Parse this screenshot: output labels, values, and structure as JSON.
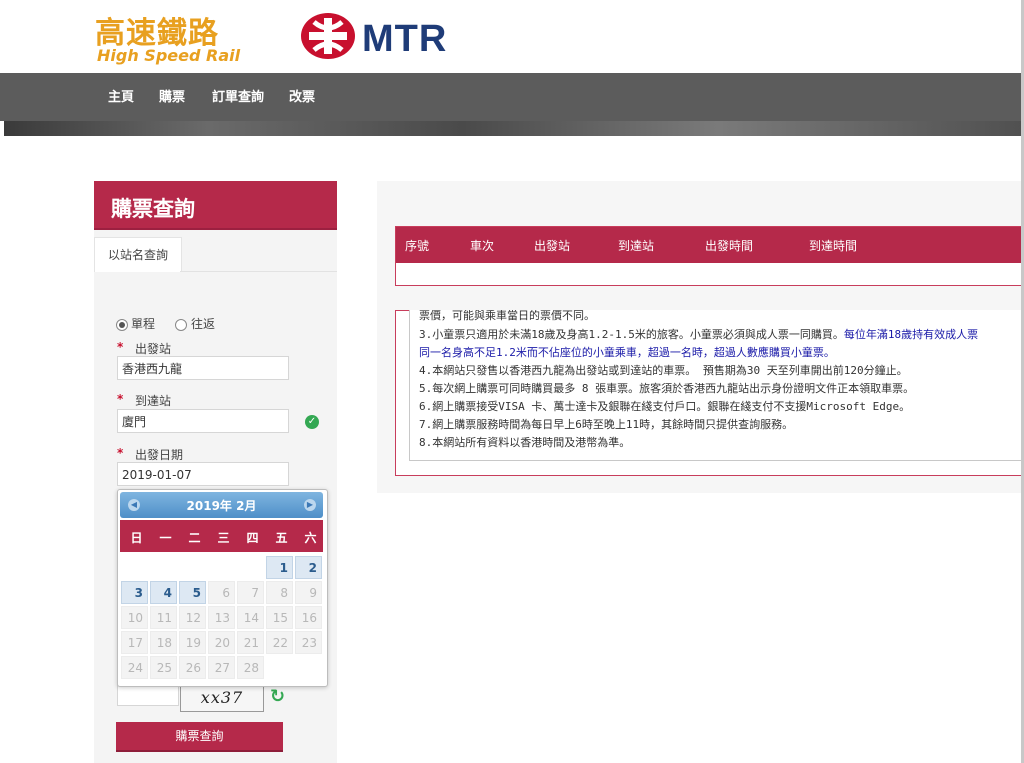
{
  "header": {
    "logo_cn": "高速鐵路",
    "logo_en": "High Speed Rail",
    "mtr_text": "MTR",
    "brand_orange": "#e8a020",
    "brand_red": "#c8102e",
    "mtr_blue": "#1f3c78"
  },
  "nav": {
    "items": [
      "主頁",
      "購票",
      "訂單查詢",
      "改票"
    ]
  },
  "panel": {
    "title": "購票查詢",
    "tab": "以站名查詢",
    "trip_one_way": "單程",
    "trip_return": "往返",
    "selected_trip": "單程",
    "departure_label": "出發站",
    "departure_value": "香港西九龍",
    "arrival_label": "到達站",
    "arrival_value": "廈門",
    "date_label": "出發日期",
    "date_value": "2019-01-07",
    "required_mark": "*",
    "captcha_text": "xx37",
    "search_button": "購票查詢",
    "accent": "#b5294a"
  },
  "calendar": {
    "title": "2019年 2月",
    "weekdays": [
      "日",
      "一",
      "二",
      "三",
      "四",
      "五",
      "六"
    ],
    "prev_icon": "prev-arrow-icon",
    "next_icon": "next-arrow-icon",
    "rows": [
      [
        "",
        "",
        "",
        "",
        "",
        "1",
        "2"
      ],
      [
        "3",
        "4",
        "5",
        "6",
        "7",
        "8",
        "9"
      ],
      [
        "10",
        "11",
        "12",
        "13",
        "14",
        "15",
        "16"
      ],
      [
        "17",
        "18",
        "19",
        "20",
        "21",
        "22",
        "23"
      ],
      [
        "24",
        "25",
        "26",
        "27",
        "28",
        "",
        ""
      ]
    ],
    "selectable_days": [
      "1",
      "2",
      "3",
      "4",
      "5"
    ]
  },
  "results": {
    "columns": [
      "序號",
      "車次",
      "出發站",
      "到達站",
      "出發時間",
      "到達時間"
    ]
  },
  "notice": {
    "lines": [
      {
        "text": "票價，可能與乘車當日的票價不同。",
        "blue": ""
      },
      {
        "text": "3.小童票只適用於未滿18歲及身高1.2-1.5米的旅客。小童票必須與成人票一同購買。",
        "blue": "每位年滿18歲持有效成人票"
      },
      {
        "text": "",
        "blue": "同一名身高不足1.2米而不佔座位的小童乘車，超過一名時，超過人數應購買小童票。"
      },
      {
        "text": "4.本網站只發售以香港西九龍為出發站或到達站的車票。 預售期為30 天至列車開出前120分鐘止。",
        "blue": ""
      },
      {
        "text": "5.每次網上購票可同時購買最多 8 張車票。旅客須於香港西九龍站出示身份證明文件正本領取車票。",
        "blue": ""
      },
      {
        "text": "6.網上購票接受VISA 卡、萬士達卡及銀聯在綫支付戶口。銀聯在綫支付不支援Microsoft Edge。",
        "blue": ""
      },
      {
        "text": "7.網上購票服務時間為每日早上6時至晚上11時，其餘時間只提供查詢服務。",
        "blue": ""
      },
      {
        "text": "8.本網站所有資料以香港時間及港幣為準。",
        "blue": ""
      }
    ]
  }
}
